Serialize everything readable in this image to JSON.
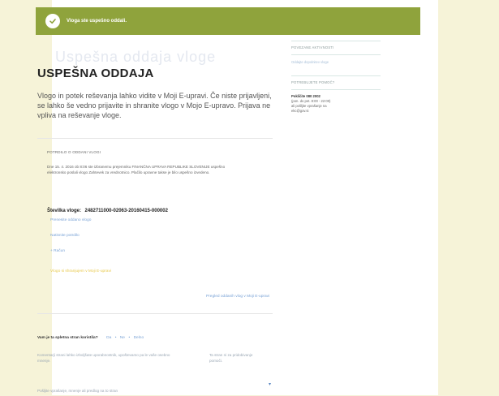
{
  "banner": {
    "message": "Vloga ste uspešno oddali."
  },
  "main": {
    "ghost_heading": "Uspešna oddaja vloge",
    "title": "USPEŠNA ODDAJA",
    "lead": "Vlogo in potek reševanja lahko vidite v Moji E-upravi. Če niste prijavljeni, se lahko še vedno prijavite in shranite vlogo v Mojo E-upravo. Prijava ne vpliva na reševanje vloge."
  },
  "confirmation": {
    "label": "POTRDILO O ODDANI VLOGI",
    "text": "Dne 15. 4. 2016 ob 8:06 ste izbranemu prejemniku FINANČNA UPRAVA REPUBLIKE SLOVENIJE uspešno elektronsko poslali vlogo Zahtevek za vrednotnico. Plačilo upravne takse je bilo uspešno izvedeno.",
    "number_label": "Številka vloge:",
    "number_value": "2482711000-02063-20160415-000002",
    "links": [
      {
        "label": "Prenesite oddano vlogo"
      },
      {
        "label": "Natisnite potrdilo"
      },
      {
        "label": "+ Račun"
      }
    ],
    "save_link": "Vlogo si shranjujem v Moji E-upravi",
    "overview_link": "Pregled oddanih vlog v Moji E-upravi"
  },
  "sidebar": {
    "related_label": "POVEZANE AKTIVNOSTI",
    "related_link": "Oddajte dopolnitev vloge",
    "help_label": "POTREBUJETE POMOČ?",
    "phone": "Pokličite 080 2002",
    "hours": "(pon. do pet. 8:00 - 22:00)",
    "email_text": "ali pošljite vprašanje na",
    "email": "ekc@gov.si"
  },
  "feedback": {
    "question": "Vam je ta spletna stran koristila?",
    "options": [
      {
        "label": "Da"
      },
      {
        "label": "Ne"
      },
      {
        "label": "Delno"
      }
    ],
    "note_left": "Komentarji strani lahko izboljšate uporabnostnik, upoštevamo pa le vaše osebno mnenje.",
    "note_right": "Ta stran ni za pridobivanje pomoči.",
    "suggest": "Pošljite vprašanje, mnenje ali predlog na to stran"
  },
  "colors": {
    "banner": "#8fa33c",
    "link": "#7aa3d6",
    "background": "#f6f3d8"
  }
}
